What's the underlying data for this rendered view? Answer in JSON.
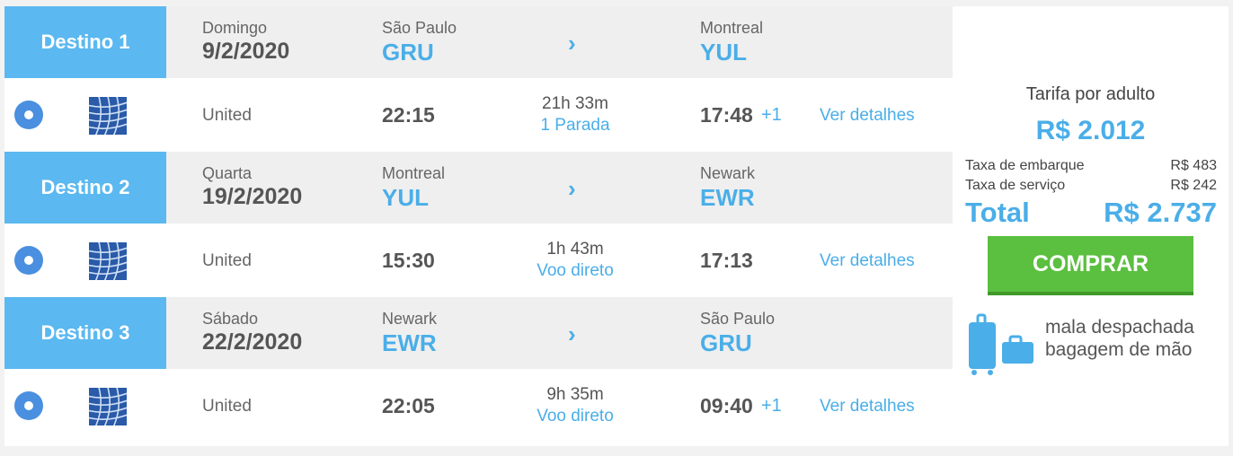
{
  "segments": [
    {
      "label": "Destino 1",
      "day": "Domingo",
      "date": "9/2/2020",
      "from_city": "São Paulo",
      "from_code": "GRU",
      "to_city": "Montreal",
      "to_code": "YUL",
      "airline": "United",
      "dep_time": "22:15",
      "duration": "21h 33m",
      "stops": "1 Parada",
      "arr_time": "17:48",
      "day_offset": "+1",
      "details": "Ver detalhes"
    },
    {
      "label": "Destino 2",
      "day": "Quarta",
      "date": "19/2/2020",
      "from_city": "Montreal",
      "from_code": "YUL",
      "to_city": "Newark",
      "to_code": "EWR",
      "airline": "United",
      "dep_time": "15:30",
      "duration": "1h 43m",
      "stops": "Voo direto",
      "arr_time": "17:13",
      "day_offset": "",
      "details": "Ver detalhes"
    },
    {
      "label": "Destino 3",
      "day": "Sábado",
      "date": "22/2/2020",
      "from_city": "Newark",
      "from_code": "EWR",
      "to_city": "São Paulo",
      "to_code": "GRU",
      "airline": "United",
      "dep_time": "22:05",
      "duration": "9h 35m",
      "stops": "Voo direto",
      "arr_time": "09:40",
      "day_offset": "+1",
      "details": "Ver detalhes"
    }
  ],
  "fare": {
    "label": "Tarifa por adulto",
    "value": "R$ 2.012",
    "boarding_tax_label": "Taxa de embarque",
    "boarding_tax_value": "R$ 483",
    "service_tax_label": "Taxa de serviço",
    "service_tax_value": "R$ 242",
    "total_label": "Total",
    "total_value": "R$ 2.737",
    "buy_label": "COMPRAR",
    "bag_checked": "mala despachada",
    "bag_hand": "bagagem de mão"
  },
  "colors": {
    "accent": "#4aaee8",
    "destino_bg": "#5bb8f0",
    "buy_green": "#5bbf3f",
    "radio_blue": "#4a8fe0"
  },
  "icons": {
    "chevron": "chevron-right-icon",
    "airline_logo": "united-globe-logo",
    "bags": "luggage-icon"
  }
}
